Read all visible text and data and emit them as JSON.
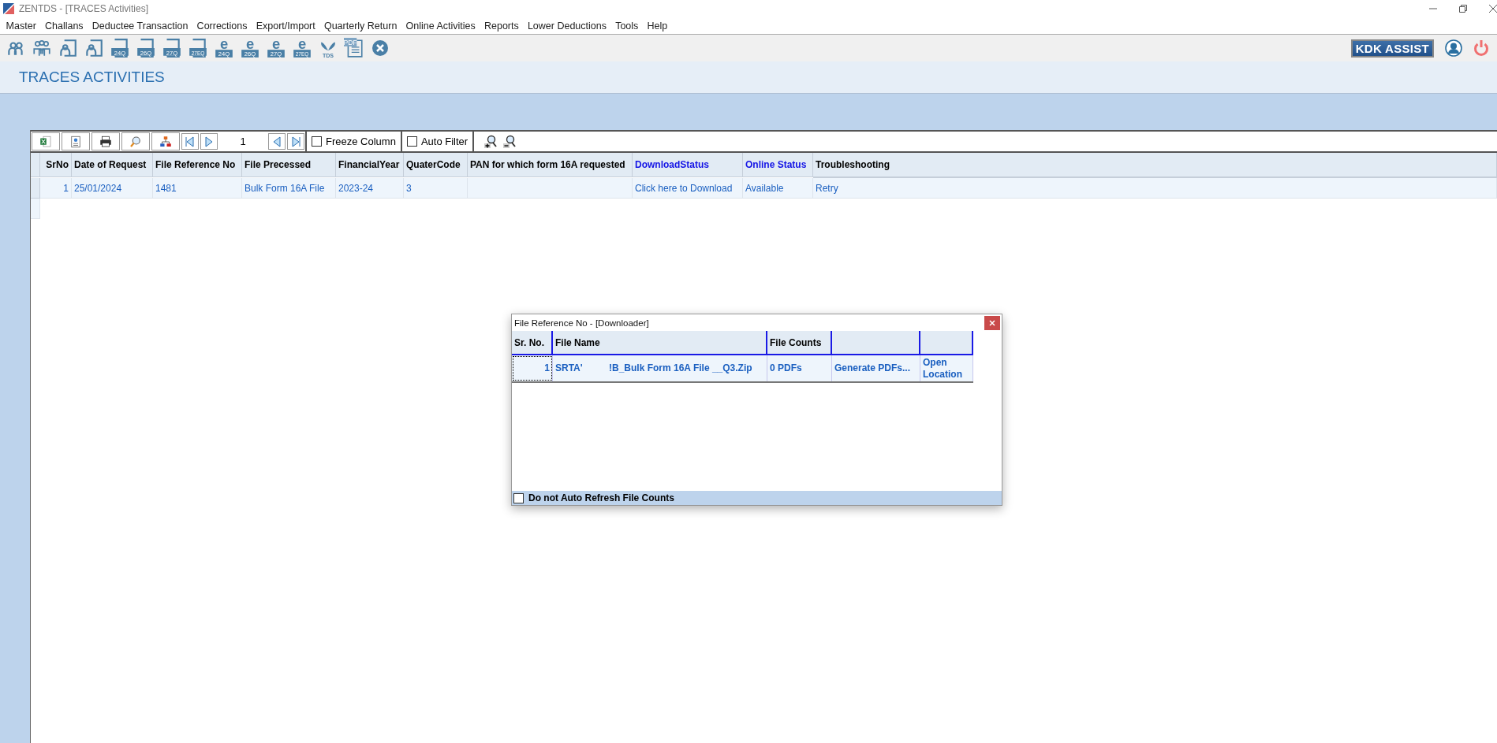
{
  "window": {
    "title": "ZENTDS - [TRACES Activities]"
  },
  "menu": [
    "Master",
    "Challans",
    "Deductee Transaction",
    "Corrections",
    "Export/Import",
    "Quarterly Return",
    "Online Activities",
    "Reports",
    "Lower Deductions",
    "Tools",
    "Help"
  ],
  "toolbar": [
    {
      "kind": "person"
    },
    {
      "kind": "people"
    },
    {
      "kind": "person-form"
    },
    {
      "kind": "person-form"
    },
    {
      "kind": "form",
      "label": "24Q"
    },
    {
      "kind": "form",
      "label": "26Q"
    },
    {
      "kind": "form",
      "label": "27Q"
    },
    {
      "kind": "form",
      "label": "27EQ"
    },
    {
      "kind": "e-form",
      "glyph": "e",
      "label": "24Q"
    },
    {
      "kind": "e-form",
      "glyph": "e",
      "label": "26Q"
    },
    {
      "kind": "e-form",
      "glyph": "e",
      "label": "27Q"
    },
    {
      "kind": "e-form",
      "glyph": "e",
      "label": "27EQ"
    },
    {
      "kind": "tds",
      "label": "TDS"
    },
    {
      "kind": "pdf",
      "label": "PDF"
    },
    {
      "kind": "close"
    }
  ],
  "assist_button": "KDK ASSIST",
  "page_title": "TRACES ACTIVITIES",
  "grid_toolbar": {
    "buttons": [
      {
        "kind": "excel"
      },
      {
        "kind": "export"
      },
      {
        "kind": "print"
      },
      {
        "kind": "find"
      },
      {
        "kind": "tree"
      }
    ],
    "nav_left": [
      {
        "kind": "first"
      },
      {
        "kind": "next"
      }
    ],
    "page": "1",
    "nav_right": [
      {
        "kind": "prev"
      },
      {
        "kind": "last"
      }
    ],
    "options": [
      {
        "label": "Freeze Column",
        "checked": false
      },
      {
        "label": "Auto Filter",
        "checked": false
      }
    ],
    "zoom": [
      {
        "kind": "zoom-in"
      },
      {
        "kind": "zoom-out"
      }
    ]
  },
  "table": {
    "columns": [
      {
        "label": "SrNo",
        "kind": "plain"
      },
      {
        "label": "Date of Request",
        "kind": "plain"
      },
      {
        "label": "File Reference No",
        "kind": "plain"
      },
      {
        "label": "File Precessed",
        "kind": "plain"
      },
      {
        "label": "FinancialYear",
        "kind": "plain"
      },
      {
        "label": "QuaterCode",
        "kind": "plain"
      },
      {
        "label": "PAN for which form 16A requested",
        "kind": "plain"
      },
      {
        "label": "DownloadStatus",
        "kind": "link"
      },
      {
        "label": "Online  Status",
        "kind": "link"
      },
      {
        "label": "Troubleshooting",
        "kind": "plain"
      }
    ],
    "rows": [
      {
        "cells": [
          "1",
          "25/01/2024",
          "1481",
          "Bulk Form 16A File",
          "2023-24",
          "3",
          "",
          "Click here to Download",
          "Available",
          "Retry"
        ]
      }
    ]
  },
  "dialog": {
    "title": "File Reference No -  [Downloader]",
    "columns": [
      "Sr. No.",
      "File Name",
      "File Counts",
      "",
      ""
    ],
    "rows": [
      {
        "cells": [
          "1",
          "SRTA'          !B_Bulk Form 16A File __Q3.Zip",
          "0 PDFs",
          "Generate PDFs...",
          "Open Location"
        ]
      }
    ],
    "footer_option": {
      "label": "Do not Auto Refresh File Counts",
      "checked": false
    }
  }
}
